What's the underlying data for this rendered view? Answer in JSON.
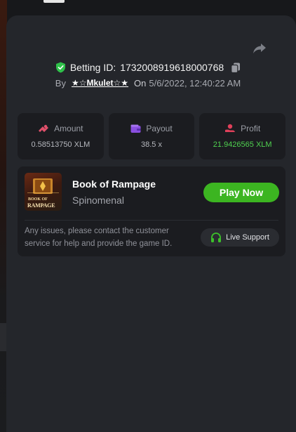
{
  "header": {
    "betting_id_label": "Betting ID:",
    "betting_id": "1732008919618000768",
    "by_label": "By",
    "username": "★☆Mkulet☆★",
    "on_label": "On",
    "datetime": "5/6/2022, 12:40:22 AM"
  },
  "stats": [
    {
      "label": "Amount",
      "value": "0.58513750 XLM",
      "icon": "coins-icon"
    },
    {
      "label": "Payout",
      "value": "38.5 x",
      "icon": "wallet-icon"
    },
    {
      "label": "Profit",
      "value": "21.9426565 XLM",
      "icon": "profit-hand-icon"
    }
  ],
  "game": {
    "name": "Book of Rampage",
    "provider": "Spinomenal",
    "thumb_title_top": "BOOK OF",
    "thumb_title_bottom": "RAMPAGE",
    "play_label": "Play Now"
  },
  "support": {
    "text": "Any issues, please contact the customer service for help and provide the game ID.",
    "button_label": "Live Support"
  },
  "colors": {
    "accent_green": "#3cb521",
    "profit_green": "#4fd14f",
    "verified_green": "#2fc14a",
    "amount_icon": "#e0506a",
    "payout_icon": "#8a4fe0",
    "profit_icon": "#e0405a"
  }
}
